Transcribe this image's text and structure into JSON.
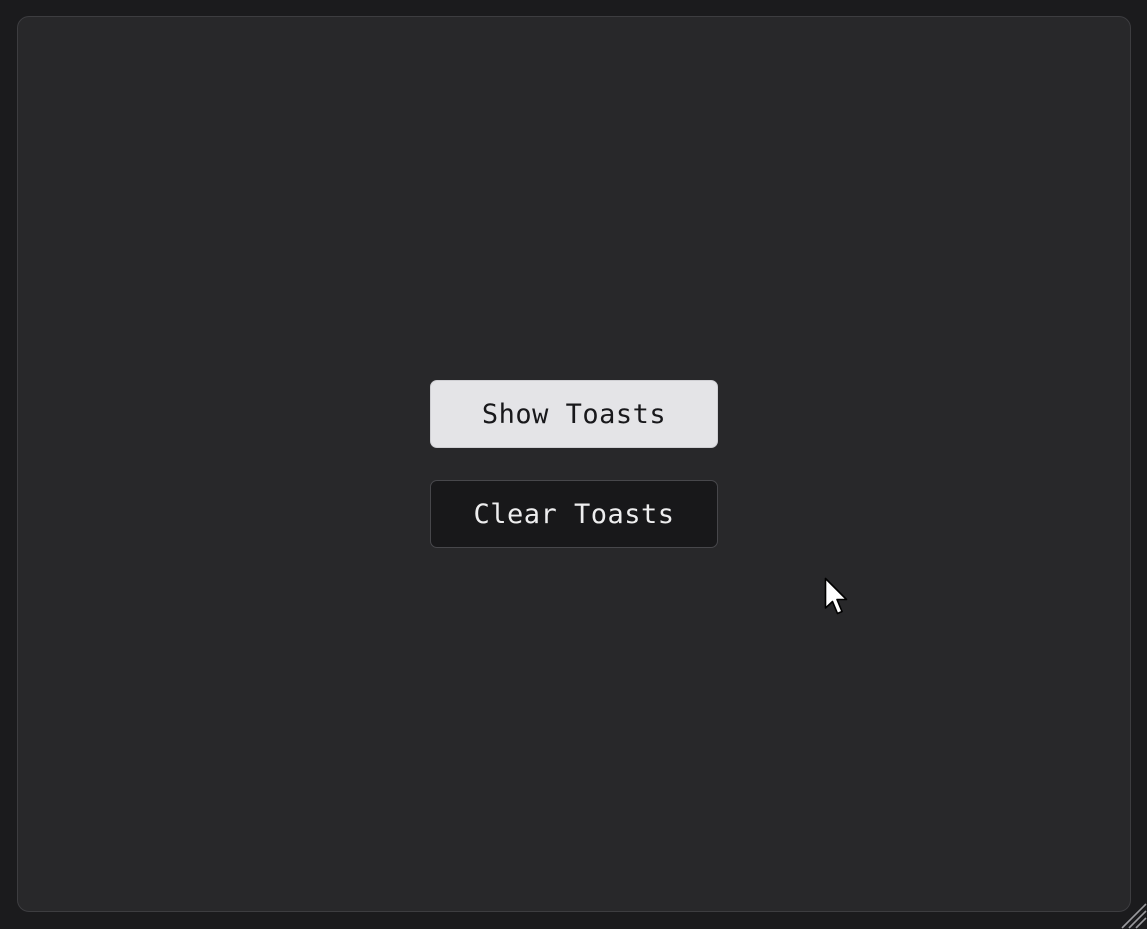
{
  "buttons": {
    "show_label": "Show Toasts",
    "clear_label": "Clear Toasts"
  },
  "icons": {
    "cursor": "mouse-pointer-icon",
    "resize": "resize-grip-icon"
  },
  "colors": {
    "background": "#1b1b1d",
    "panel": "#28282a",
    "panel_border": "#3d3d40",
    "primary_button_bg": "#e4e4e7",
    "primary_button_text": "#18181b",
    "secondary_button_bg": "#18181a",
    "secondary_button_text": "#eeeeef"
  }
}
